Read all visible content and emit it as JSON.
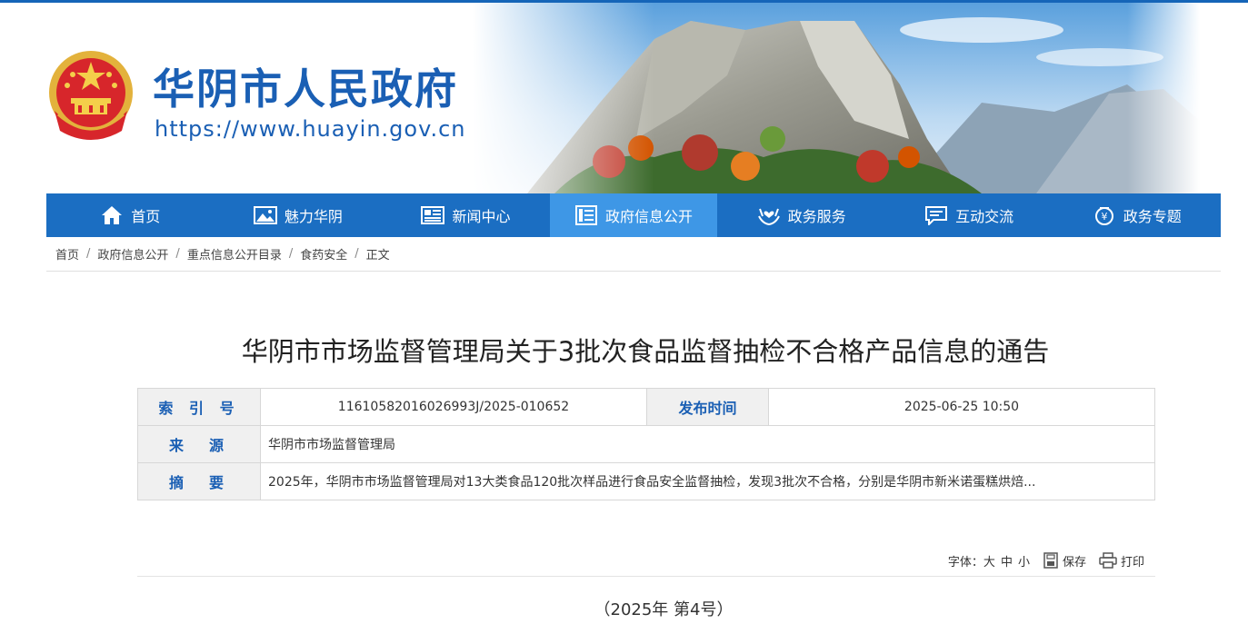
{
  "header": {
    "site_title": "华阴市人民政府",
    "site_url": "https://www.huayin.gov.cn"
  },
  "nav": {
    "items": [
      {
        "label": "首页",
        "icon": "home-icon"
      },
      {
        "label": "魅力华阴",
        "icon": "picture-icon"
      },
      {
        "label": "新闻中心",
        "icon": "newspaper-icon"
      },
      {
        "label": "政府信息公开",
        "icon": "document-list-icon",
        "active": true
      },
      {
        "label": "政务服务",
        "icon": "hands-heart-icon"
      },
      {
        "label": "互动交流",
        "icon": "chat-icon"
      },
      {
        "label": "政务专题",
        "icon": "money-bag-icon"
      }
    ]
  },
  "breadcrumb": {
    "items": [
      "首页",
      "政府信息公开",
      "重点信息公开目录",
      "食药安全",
      "正文"
    ]
  },
  "article": {
    "title": "华阴市市场监督管理局关于3批次食品监督抽检不合格产品信息的通告",
    "meta": {
      "index_label": "索 引 号",
      "index_value": "11610582016026993J/2025-010652",
      "date_label": "发布时间",
      "date_value": "2025-06-25 10:50",
      "source_label": "来　源",
      "source_value": "华阴市市场监督管理局",
      "abstract_label": "摘　要",
      "abstract_value": "2025年，华阴市市场监督管理局对13大类食品120批次样品进行食品安全监督抽检，发现3批次不合格，分别是华阴市新米诺蛋糕烘焙..."
    },
    "tools": {
      "font_label": "字体：",
      "size_large": "大",
      "size_medium": "中",
      "size_small": "小",
      "save": "保存",
      "print": "打印"
    },
    "doc_number": "（2025年 第4号）"
  },
  "colors": {
    "brand_blue": "#1b6ec2",
    "nav_active": "#3e97e6",
    "title_blue": "#1a5fb4"
  }
}
